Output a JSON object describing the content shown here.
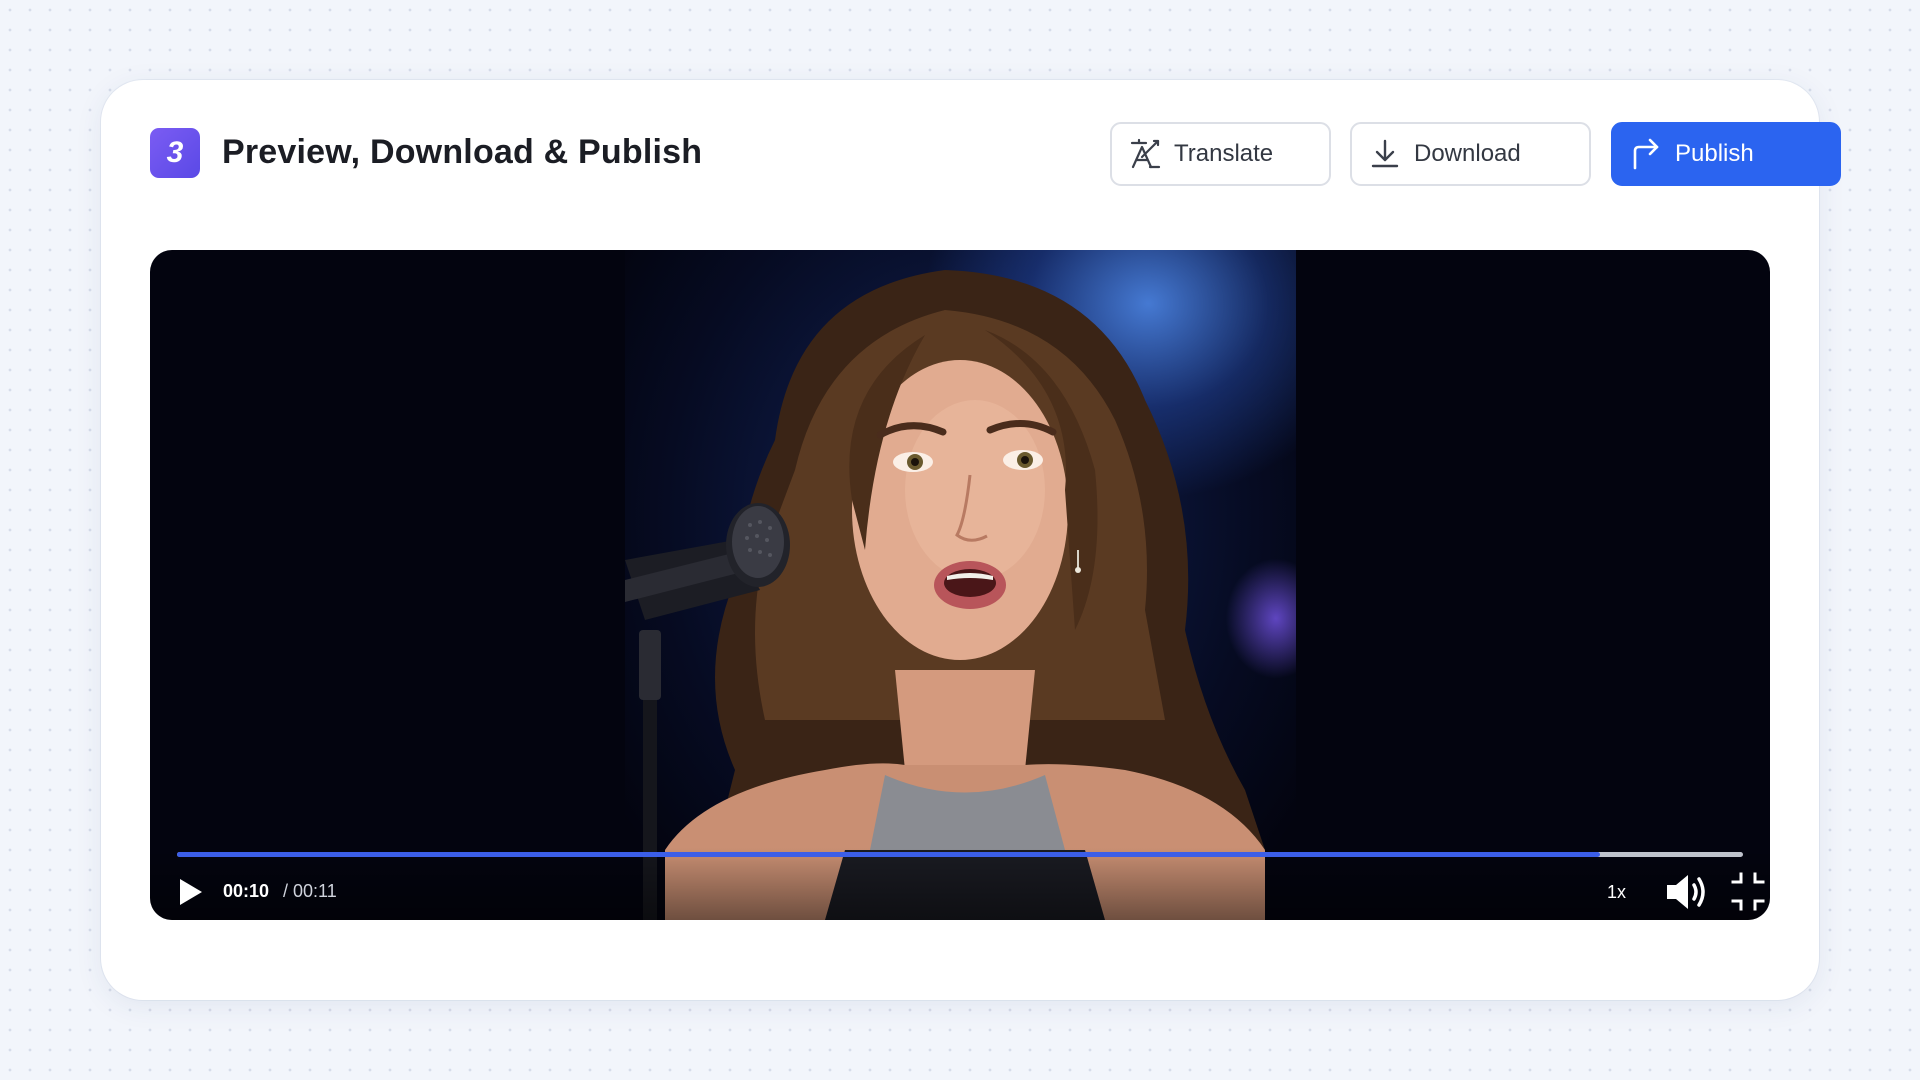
{
  "header": {
    "step_number": "3",
    "title": "Preview, Download & Publish"
  },
  "toolbar": {
    "translate_label": "Translate",
    "download_label": "Download",
    "publish_label": "Publish"
  },
  "player": {
    "current_time": "00:10",
    "total_time": "/ 00:11",
    "progress_fraction": 0.909,
    "speed_label": "1x",
    "video_description": "singer-with-microphone"
  },
  "icons": {
    "translate": "translate-icon",
    "download": "download-icon",
    "publish": "share-arrow-icon",
    "play": "play-icon",
    "volume": "volume-icon",
    "fullscreen": "exit-fullscreen-icon"
  },
  "colors": {
    "accent": "#2b64f0",
    "badge": "#6a52ee",
    "progress": "#3b5ee8"
  }
}
